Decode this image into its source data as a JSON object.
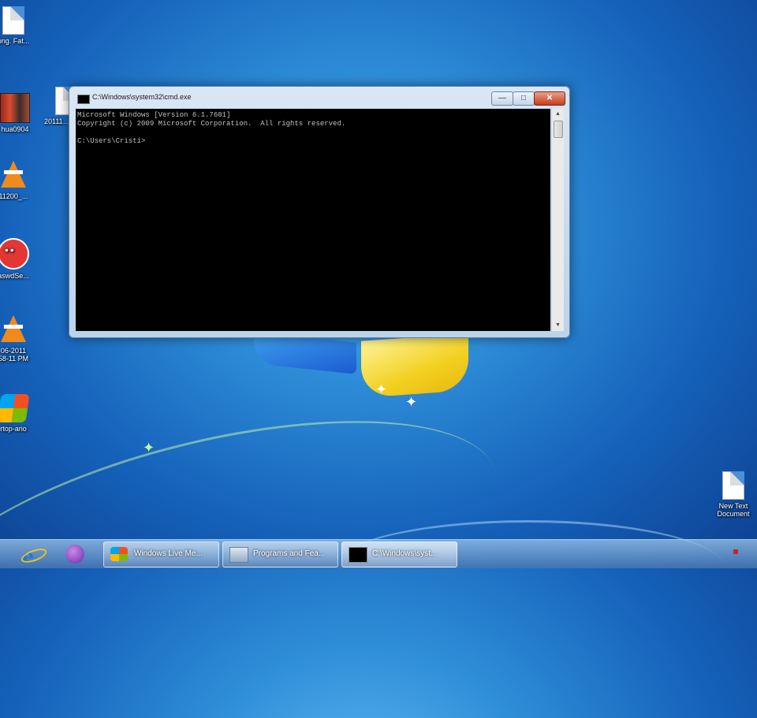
{
  "desktop": {
    "icons_left": [
      {
        "icon": "excel-document-icon",
        "label": "ong. Fat..."
      },
      {
        "icon": "video-thumbnail-icon",
        "label": "hua0904"
      },
      {
        "icon": "vlc-cone-icon",
        "label": "11200_..."
      },
      {
        "icon": "messenger-bubble-icon",
        "label": "aswdSe..."
      },
      {
        "icon": "vlc-cone-icon",
        "label": "06-2011"
      },
      {
        "icon": "windows-logo-icon",
        "label": "rtop-ario"
      }
    ],
    "icon_partial_label": "20111...",
    "icon_vlc2_sub": "58-11 PM",
    "icon_right": {
      "icon": "text-document-icon",
      "label_line1": "New Text",
      "label_line2": "Document"
    }
  },
  "cmd_window": {
    "title": "C:\\Windows\\system32\\cmd.exe",
    "controls": {
      "minimize": "—",
      "maximize": "□",
      "close": "✕"
    },
    "lines": [
      "Microsoft Windows [Version 6.1.7601]",
      "Copyright (c) 2009 Microsoft Corporation.  All rights reserved.",
      "",
      "C:\\Users\\Cristi>"
    ]
  },
  "taskbar": {
    "pinned": [
      {
        "name": "internet-explorer",
        "icon": "internet-explorer-icon"
      },
      {
        "name": "messenger",
        "icon": "messenger-icon"
      }
    ],
    "tasks": [
      {
        "label": "Windows Live Me...",
        "icon": "windows-live-icon",
        "active": false
      },
      {
        "label": "Programs and Fea...",
        "icon": "programs-features-icon",
        "active": false
      },
      {
        "label": "C:\\Windows\\syst...",
        "icon": "cmd-icon",
        "active": true
      }
    ]
  }
}
